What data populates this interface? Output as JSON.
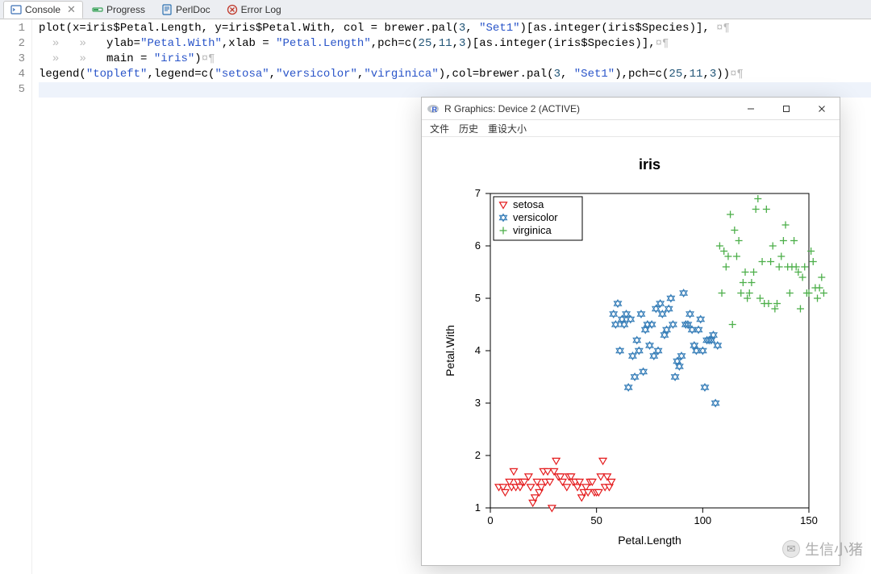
{
  "tabs": [
    {
      "label": "Console",
      "icon": "console-icon",
      "active": true,
      "closable": true
    },
    {
      "label": "Progress",
      "icon": "progress-icon",
      "active": false,
      "closable": false
    },
    {
      "label": "PerlDoc",
      "icon": "perldoc-icon",
      "active": false,
      "closable": false
    },
    {
      "label": "Error Log",
      "icon": "errorlog-icon",
      "active": false,
      "closable": false
    }
  ],
  "code_lines": [
    "plot(x=iris$Petal.Length, y=iris$Petal.With, col = brewer.pal(3, \"Set1\")[as.integer(iris$Species)], ¤¶",
    "  »   »   ylab=\"Petal.With\",xlab = \"Petal.Length\",pch=c(25,11,3)[as.integer(iris$Species)],¤¶",
    "  »   »   main = \"iris\")¤¶",
    "legend(\"topleft\",legend=c(\"setosa\",\"versicolor\",\"virginica\"),col=brewer.pal(3, \"Set1\"),pch=c(25,11,3))¤¶",
    ""
  ],
  "line_numbers": [
    "1",
    "2",
    "3",
    "4",
    "5"
  ],
  "rwin": {
    "title": "R Graphics: Device 2 (ACTIVE)",
    "menu": {
      "file": "文件",
      "history": "历史",
      "resize": "重设大小"
    }
  },
  "chart_data": {
    "type": "scatter",
    "title": "iris",
    "xlabel": "Petal.Length",
    "ylabel": "Petal.With",
    "xlim": [
      0,
      150
    ],
    "xticks": [
      0,
      50,
      100,
      150
    ],
    "ylim": [
      1,
      7
    ],
    "yticks": [
      1,
      2,
      3,
      4,
      5,
      6,
      7
    ],
    "legend": {
      "position": "topleft",
      "entries": [
        "setosa",
        "versicolor",
        "virginica"
      ]
    },
    "colors": {
      "setosa": "#e41a1c",
      "versicolor": "#377eb8",
      "virginica": "#4daf4a"
    },
    "pch": {
      "setosa": 25,
      "versicolor": 11,
      "virginica": 3
    },
    "series": [
      {
        "name": "setosa",
        "points": [
          [
            4,
            1.4
          ],
          [
            6,
            1.4
          ],
          [
            7,
            1.3
          ],
          [
            9,
            1.5
          ],
          [
            10,
            1.4
          ],
          [
            11,
            1.7
          ],
          [
            12,
            1.4
          ],
          [
            13,
            1.5
          ],
          [
            14,
            1.4
          ],
          [
            15,
            1.5
          ],
          [
            16,
            1.5
          ],
          [
            18,
            1.6
          ],
          [
            19,
            1.4
          ],
          [
            20,
            1.1
          ],
          [
            21,
            1.2
          ],
          [
            22,
            1.5
          ],
          [
            23,
            1.3
          ],
          [
            24,
            1.4
          ],
          [
            25,
            1.7
          ],
          [
            26,
            1.5
          ],
          [
            27,
            1.7
          ],
          [
            28,
            1.5
          ],
          [
            29,
            1.0
          ],
          [
            30,
            1.7
          ],
          [
            31,
            1.9
          ],
          [
            32,
            1.6
          ],
          [
            33,
            1.6
          ],
          [
            34,
            1.5
          ],
          [
            36,
            1.4
          ],
          [
            37,
            1.6
          ],
          [
            38,
            1.6
          ],
          [
            39,
            1.5
          ],
          [
            40,
            1.5
          ],
          [
            41,
            1.4
          ],
          [
            42,
            1.5
          ],
          [
            43,
            1.2
          ],
          [
            44,
            1.3
          ],
          [
            45,
            1.4
          ],
          [
            46,
            1.3
          ],
          [
            47,
            1.5
          ],
          [
            49,
            1.3
          ],
          [
            50,
            1.3
          ],
          [
            51,
            1.3
          ],
          [
            52,
            1.6
          ],
          [
            53,
            1.9
          ],
          [
            54,
            1.4
          ],
          [
            55,
            1.6
          ],
          [
            56,
            1.4
          ],
          [
            48,
            1.5
          ],
          [
            57,
            1.5
          ]
        ]
      },
      {
        "name": "versicolor",
        "points": [
          [
            58,
            4.7
          ],
          [
            59,
            4.5
          ],
          [
            60,
            4.9
          ],
          [
            61,
            4.0
          ],
          [
            62,
            4.6
          ],
          [
            63,
            4.5
          ],
          [
            64,
            4.7
          ],
          [
            65,
            3.3
          ],
          [
            66,
            4.6
          ],
          [
            67,
            3.9
          ],
          [
            68,
            3.5
          ],
          [
            69,
            4.2
          ],
          [
            70,
            4.0
          ],
          [
            71,
            4.7
          ],
          [
            72,
            3.6
          ],
          [
            73,
            4.4
          ],
          [
            74,
            4.5
          ],
          [
            75,
            4.1
          ],
          [
            76,
            4.5
          ],
          [
            77,
            3.9
          ],
          [
            78,
            4.8
          ],
          [
            79,
            4.0
          ],
          [
            80,
            4.9
          ],
          [
            81,
            4.7
          ],
          [
            82,
            4.3
          ],
          [
            83,
            4.4
          ],
          [
            84,
            4.8
          ],
          [
            85,
            5.0
          ],
          [
            86,
            4.5
          ],
          [
            87,
            3.5
          ],
          [
            88,
            3.8
          ],
          [
            89,
            3.7
          ],
          [
            90,
            3.9
          ],
          [
            91,
            5.1
          ],
          [
            92,
            4.5
          ],
          [
            93,
            4.5
          ],
          [
            94,
            4.7
          ],
          [
            95,
            4.4
          ],
          [
            96,
            4.1
          ],
          [
            97,
            4.0
          ],
          [
            98,
            4.4
          ],
          [
            99,
            4.6
          ],
          [
            100,
            4.0
          ],
          [
            101,
            3.3
          ],
          [
            102,
            4.2
          ],
          [
            103,
            4.2
          ],
          [
            104,
            4.2
          ],
          [
            105,
            4.3
          ],
          [
            106,
            3.0
          ],
          [
            107,
            4.1
          ]
        ]
      },
      {
        "name": "virginica",
        "points": [
          [
            108,
            6.0
          ],
          [
            109,
            5.1
          ],
          [
            110,
            5.9
          ],
          [
            111,
            5.6
          ],
          [
            112,
            5.8
          ],
          [
            113,
            6.6
          ],
          [
            114,
            4.5
          ],
          [
            115,
            6.3
          ],
          [
            116,
            5.8
          ],
          [
            117,
            6.1
          ],
          [
            118,
            5.1
          ],
          [
            119,
            5.3
          ],
          [
            120,
            5.5
          ],
          [
            121,
            5.0
          ],
          [
            122,
            5.1
          ],
          [
            123,
            5.3
          ],
          [
            124,
            5.5
          ],
          [
            125,
            6.7
          ],
          [
            126,
            6.9
          ],
          [
            127,
            5.0
          ],
          [
            128,
            5.7
          ],
          [
            129,
            4.9
          ],
          [
            130,
            6.7
          ],
          [
            131,
            4.9
          ],
          [
            132,
            5.7
          ],
          [
            133,
            6.0
          ],
          [
            134,
            4.8
          ],
          [
            135,
            4.9
          ],
          [
            136,
            5.6
          ],
          [
            137,
            5.8
          ],
          [
            138,
            6.1
          ],
          [
            139,
            6.4
          ],
          [
            140,
            5.6
          ],
          [
            141,
            5.1
          ],
          [
            142,
            5.6
          ],
          [
            143,
            6.1
          ],
          [
            144,
            5.6
          ],
          [
            145,
            5.5
          ],
          [
            146,
            4.8
          ],
          [
            147,
            5.4
          ],
          [
            148,
            5.6
          ],
          [
            149,
            5.1
          ],
          [
            150,
            5.1
          ],
          [
            151,
            5.9
          ],
          [
            152,
            5.7
          ],
          [
            153,
            5.2
          ],
          [
            154,
            5.0
          ],
          [
            155,
            5.2
          ],
          [
            156,
            5.4
          ],
          [
            157,
            5.1
          ]
        ]
      }
    ]
  },
  "watermark": "生信小猪"
}
